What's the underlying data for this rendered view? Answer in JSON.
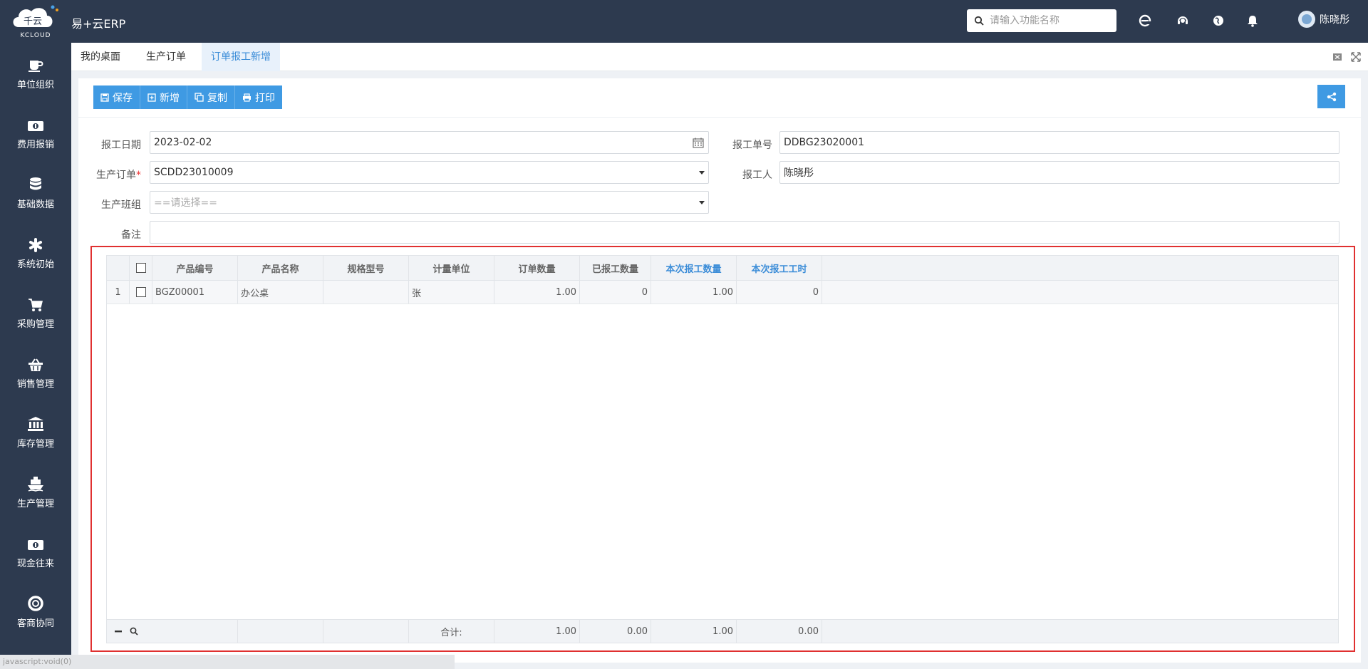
{
  "app": {
    "logo_text": "千云",
    "logo_sub": "KCLOUD",
    "title": "易+云ERP"
  },
  "search": {
    "placeholder": "请输入功能名称"
  },
  "user": {
    "name": "陈晓彤"
  },
  "top_icons": [
    "browser-e-icon",
    "support-headset-icon",
    "globe-icon",
    "bell-icon"
  ],
  "sidebar": {
    "items": [
      {
        "label": "单位组织",
        "icon": "cup-icon"
      },
      {
        "label": "费用报销",
        "icon": "money-icon"
      },
      {
        "label": "基础数据",
        "icon": "database-icon"
      },
      {
        "label": "系统初始",
        "icon": "asterisk-icon"
      },
      {
        "label": "采购管理",
        "icon": "cart-icon"
      },
      {
        "label": "销售管理",
        "icon": "basket-icon"
      },
      {
        "label": "库存管理",
        "icon": "bank-icon"
      },
      {
        "label": "生产管理",
        "icon": "ship-icon"
      },
      {
        "label": "现金往来",
        "icon": "money-icon"
      },
      {
        "label": "客商协同",
        "icon": "lifebuoy-icon"
      }
    ]
  },
  "tabs": [
    {
      "label": "我的桌面"
    },
    {
      "label": "生产订单"
    },
    {
      "label": "订单报工新增",
      "active": true
    }
  ],
  "toolbar": {
    "save": "保存",
    "add": "新增",
    "copy": "复制",
    "print": "打印"
  },
  "form": {
    "report_date_label": "报工日期",
    "report_date_value": "2023-02-02",
    "report_no_label": "报工单号",
    "report_no_value": "DDBG23020001",
    "prod_order_label": "生产订单",
    "prod_order_value": "SCDD23010009",
    "reporter_label": "报工人",
    "reporter_value": "陈晓彤",
    "team_label": "生产班组",
    "team_placeholder": "==请选择==",
    "remark_label": "备注",
    "remark_value": ""
  },
  "grid": {
    "columns": [
      "产品编号",
      "产品名称",
      "规格型号",
      "计量单位",
      "订单数量",
      "已报工数量",
      "本次报工数量",
      "本次报工工时"
    ],
    "rows": [
      {
        "index": "1",
        "code": "BGZ00001",
        "name": "办公桌",
        "spec": "",
        "unit": "张",
        "order_qty": "1.00",
        "reported_qty": "0",
        "this_qty": "1.00",
        "this_hours": "0"
      }
    ],
    "footer": {
      "total_label": "合计:",
      "order_qty": "1.00",
      "reported_qty": "0.00",
      "this_qty": "1.00",
      "this_hours": "0.00"
    }
  },
  "statusbar": {
    "text": "javascript:void(0)"
  },
  "colors": {
    "topbar": "#2d3a4f",
    "accent": "#3f9ae3",
    "highlight_box": "#e03030"
  }
}
